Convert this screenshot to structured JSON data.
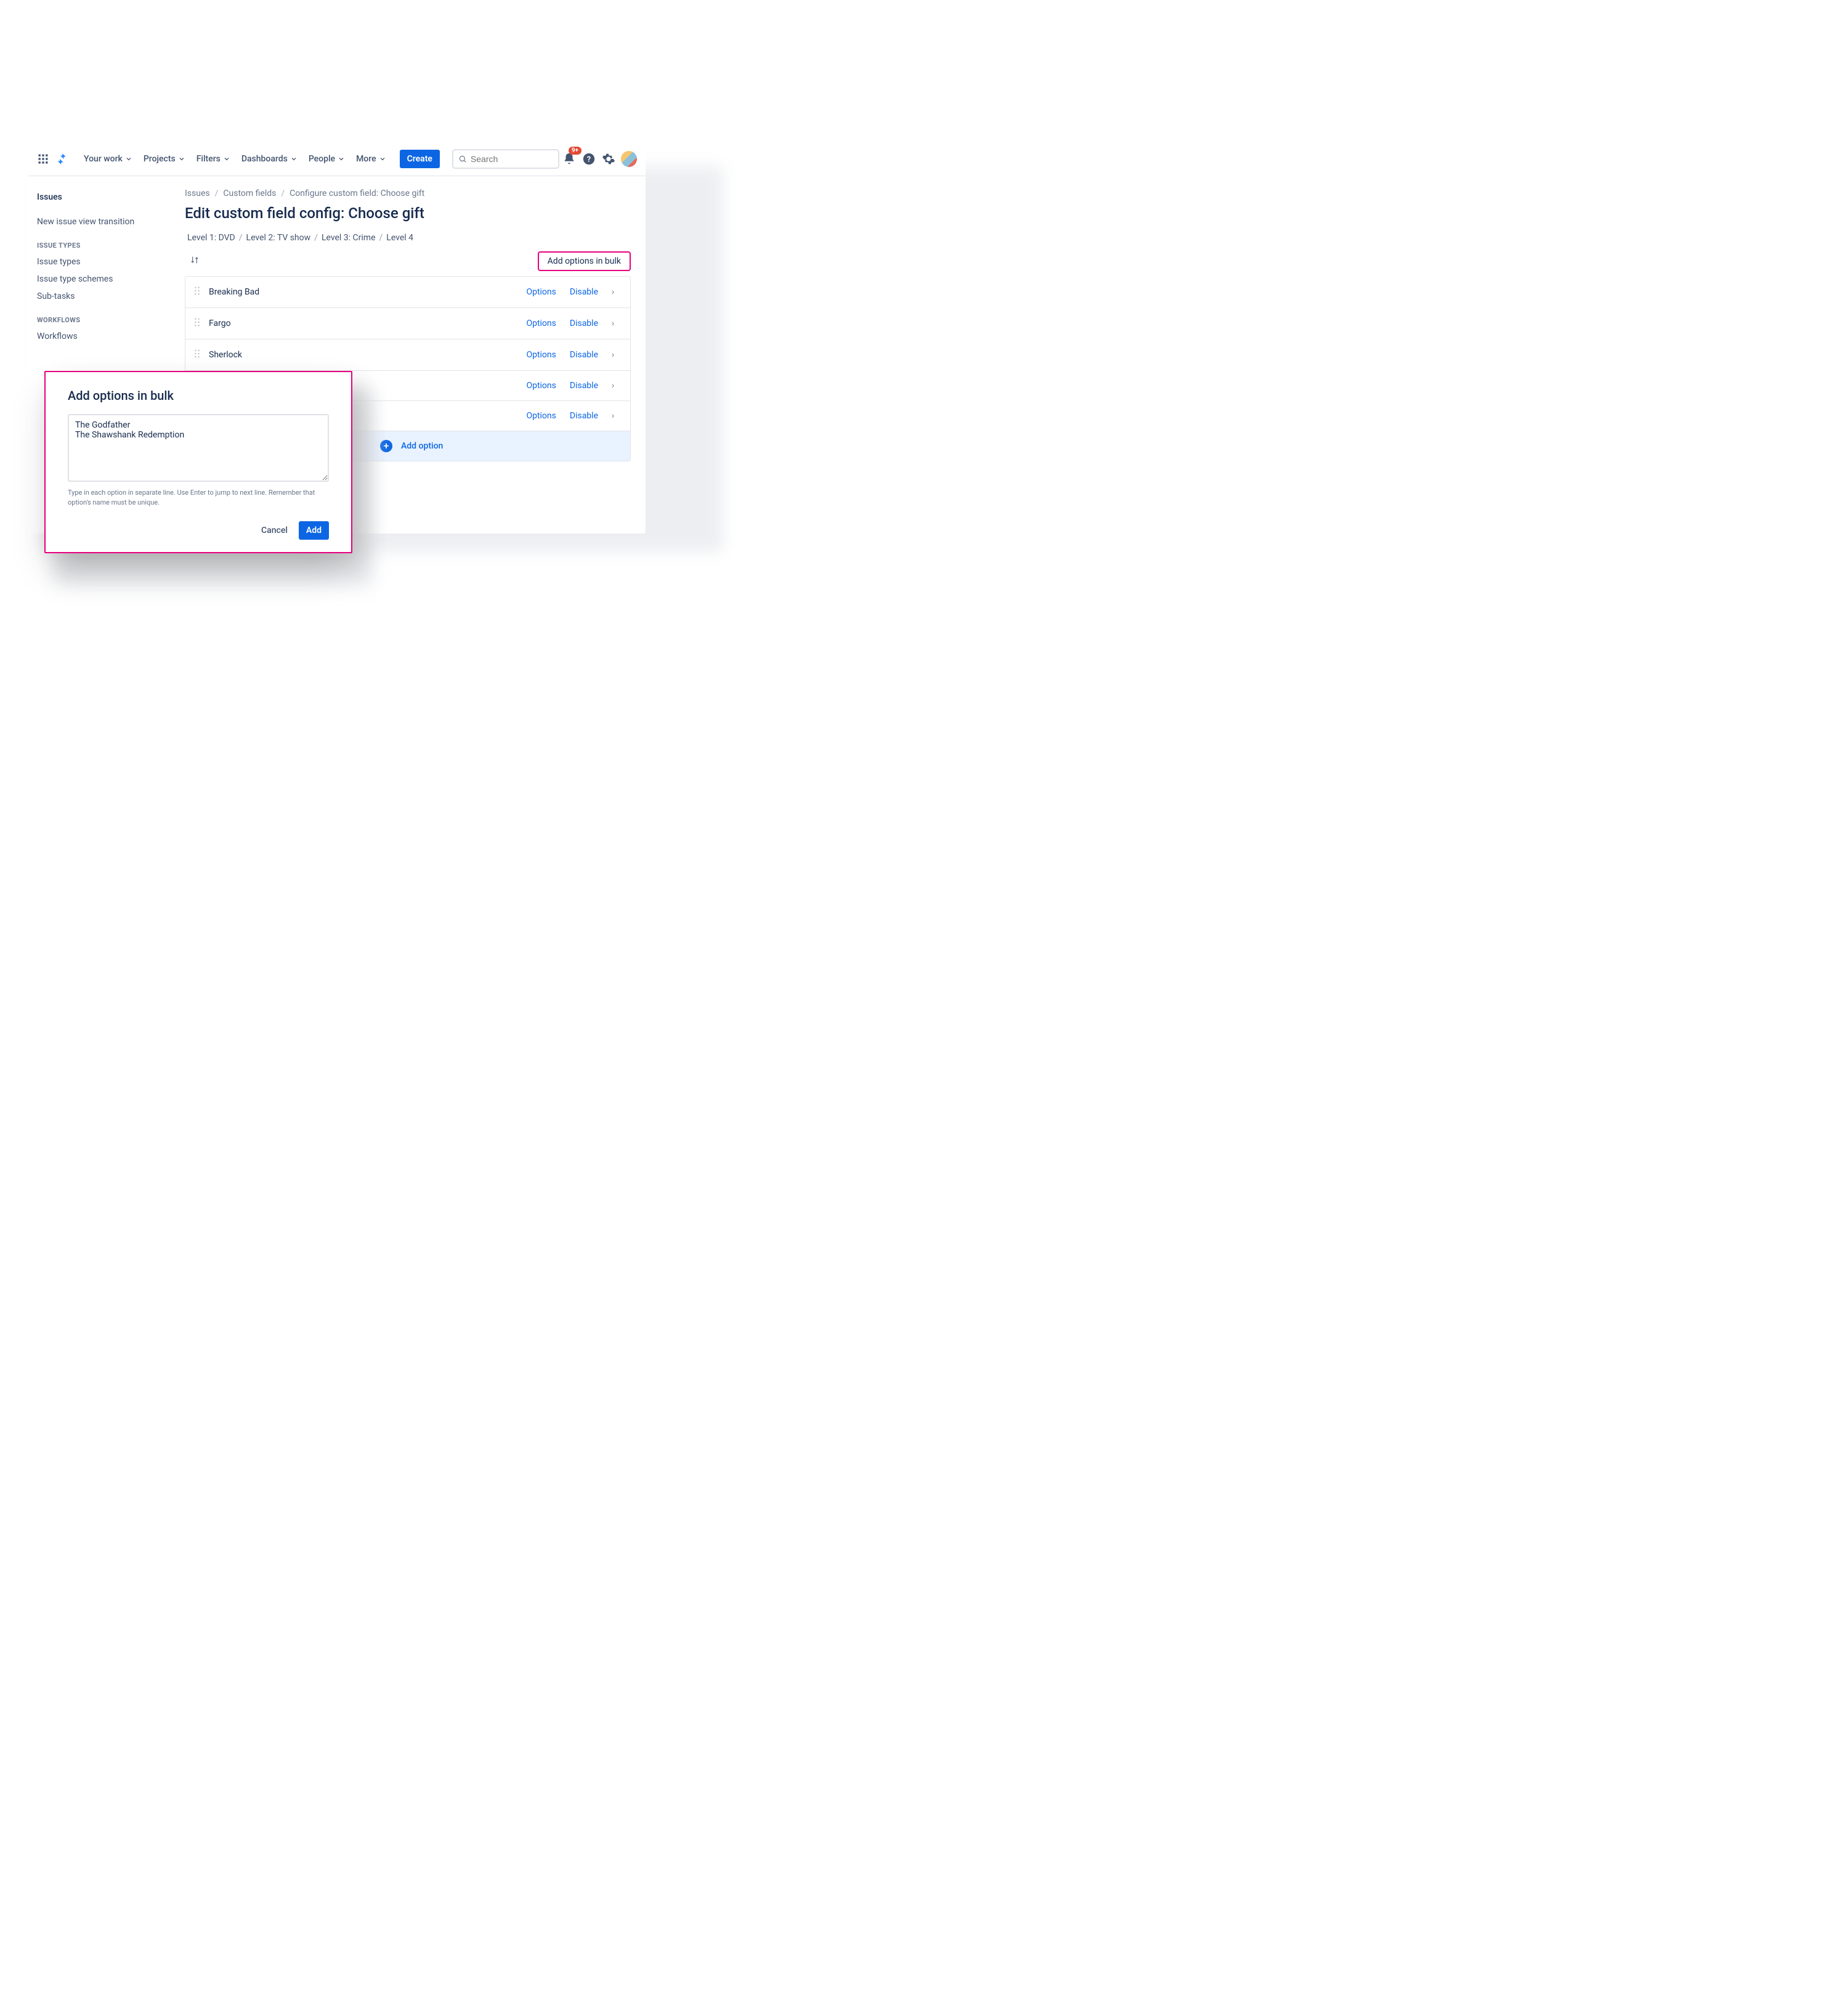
{
  "nav": {
    "items": [
      "Your work",
      "Projects",
      "Filters",
      "Dashboards",
      "People",
      "More"
    ],
    "create": "Create",
    "search_placeholder": "Search",
    "notif_badge": "9+"
  },
  "sidebar": {
    "top": "Issues",
    "link1": "New issue view transition",
    "group1_head": "Issue types",
    "group1": [
      "Issue types",
      "Issue type schemes",
      "Sub-tasks"
    ],
    "group2_head": "Workflows",
    "group2": [
      "Workflows"
    ]
  },
  "crumbs": {
    "a": "Issues",
    "b": "Custom fields",
    "c": "Configure custom field: Choose gift"
  },
  "title": "Edit custom field config: Choose gift",
  "levels": {
    "l1": "Level 1: DVD",
    "l2": "Level 2: TV show",
    "l3": "Level 3: Crime",
    "l4": "Level 4"
  },
  "bulk_label": "Add options in bulk",
  "option_actions": {
    "options": "Options",
    "disable": "Disable"
  },
  "options": [
    {
      "name": "Breaking Bad"
    },
    {
      "name": "Fargo"
    },
    {
      "name": "Sherlock"
    },
    {
      "name": ""
    },
    {
      "name": ""
    }
  ],
  "add_option": "Add option",
  "dialog": {
    "title": "Add options in bulk",
    "value": "The Godfather\nThe Shawshank Redemption",
    "help": "Type in each option in separate line. Use Enter to jump to next line. Remember that option's name must be unique.",
    "cancel": "Cancel",
    "add": "Add"
  }
}
